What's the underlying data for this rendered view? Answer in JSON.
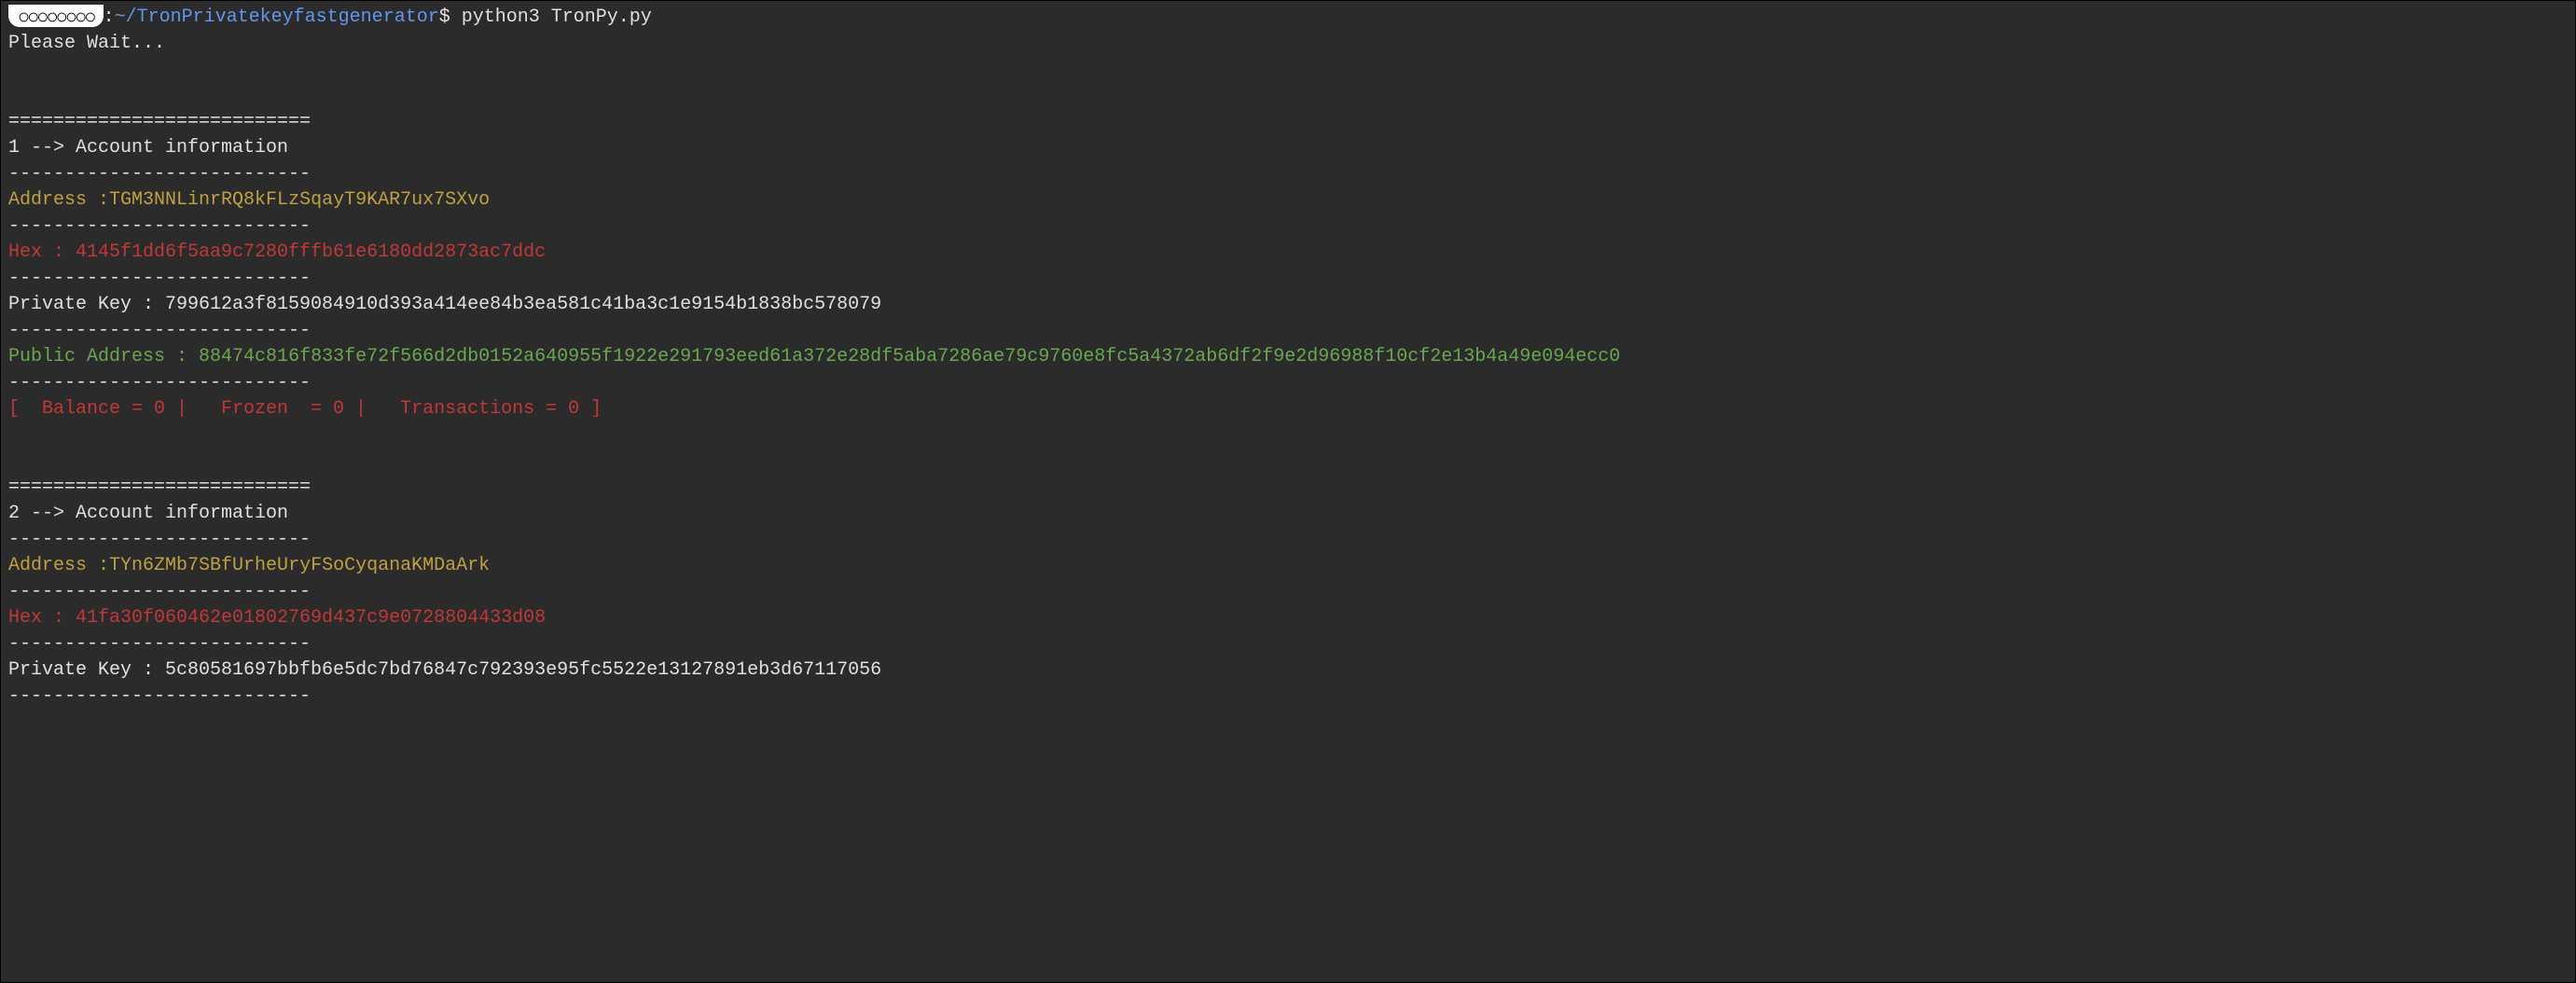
{
  "prompt": {
    "redacted": "○○○○○○○○",
    "colon": ":",
    "path": "~/TronPrivatekeyfastgenerator",
    "dollar": "$ ",
    "command": "python3 TronPy.py"
  },
  "wait_text": "Please Wait...",
  "sep_eq": "===========================",
  "sep_dash": "---------------------------",
  "accounts": [
    {
      "header": "1 --> Account information",
      "address_label": "Address :",
      "address": "TGM3NNLinrRQ8kFLzSqayT9KAR7ux7SXvo",
      "hex_label": "Hex : ",
      "hex": "4145f1dd6f5aa9c7280fffb61e6180dd2873ac7ddc",
      "privkey_label": "Private Key : ",
      "privkey": "799612a3f8159084910d393a414ee84b3ea581c41ba3c1e9154b1838bc578079",
      "pubaddr_label": "Public Address : ",
      "pubaddr": "88474c816f833fe72f566d2db0152a640955f1922e291793eed61a372e28df5aba7286ae79c9760e8fc5a4372ab6df2f9e2d96988f10cf2e13b4a49e094ecc0",
      "stats": "[  Balance = 0 |   Frozen  = 0 |   Transactions = 0 ]"
    },
    {
      "header": "2 --> Account information",
      "address_label": "Address :",
      "address": "TYn6ZMb7SBfUrheUryFSoCyqanaKMDaArk",
      "hex_label": "Hex : ",
      "hex": "41fa30f060462e01802769d437c9e0728804433d08",
      "privkey_label": "Private Key : ",
      "privkey": "5c80581697bbfb6e5dc7bd76847c792393e95fc5522e13127891eb3d67117056"
    }
  ]
}
